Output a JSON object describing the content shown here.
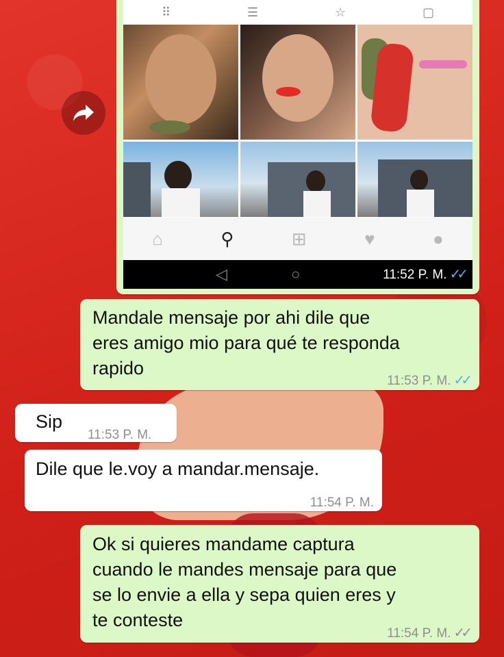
{
  "messages": [
    {
      "id": "m1",
      "direction": "outgoing",
      "text": "Mandale mensaje por ahi dile que\neres amigo mio para qué te responda\nrapido",
      "time": "11:53 P. M.",
      "ticks": "✓✓",
      "read": true
    },
    {
      "id": "m2",
      "direction": "incoming",
      "text": "Sip",
      "time": "11:53 P. M."
    },
    {
      "id": "m3",
      "direction": "incoming",
      "text": "Dile que le.voy a mandar.mensaje.",
      "time": "11:54 P. M."
    },
    {
      "id": "m4",
      "direction": "outgoing",
      "text": "Ok si quieres mandame captura\ncuando le mandes mensaje para que\nse lo envie a ella y sepa quien eres y\nte conteste",
      "time": "11:54 P. M.",
      "ticks": "✓✓",
      "read": false
    }
  ],
  "image_message": {
    "time": "11:52 P. M.",
    "ticks": "✓✓",
    "read": true
  },
  "icons": {
    "forward": "forward-arrow-icon",
    "ig_nav": [
      "home-icon",
      "search-icon",
      "add-icon",
      "heart-icon",
      "profile-icon"
    ],
    "android_nav": [
      "back-icon",
      "home-circle-icon"
    ]
  },
  "colors": {
    "background": "#d8261e",
    "outgoing_bubble": "#dcf8c6",
    "incoming_bubble": "#ffffff",
    "read_ticks": "#4fb5e8"
  }
}
